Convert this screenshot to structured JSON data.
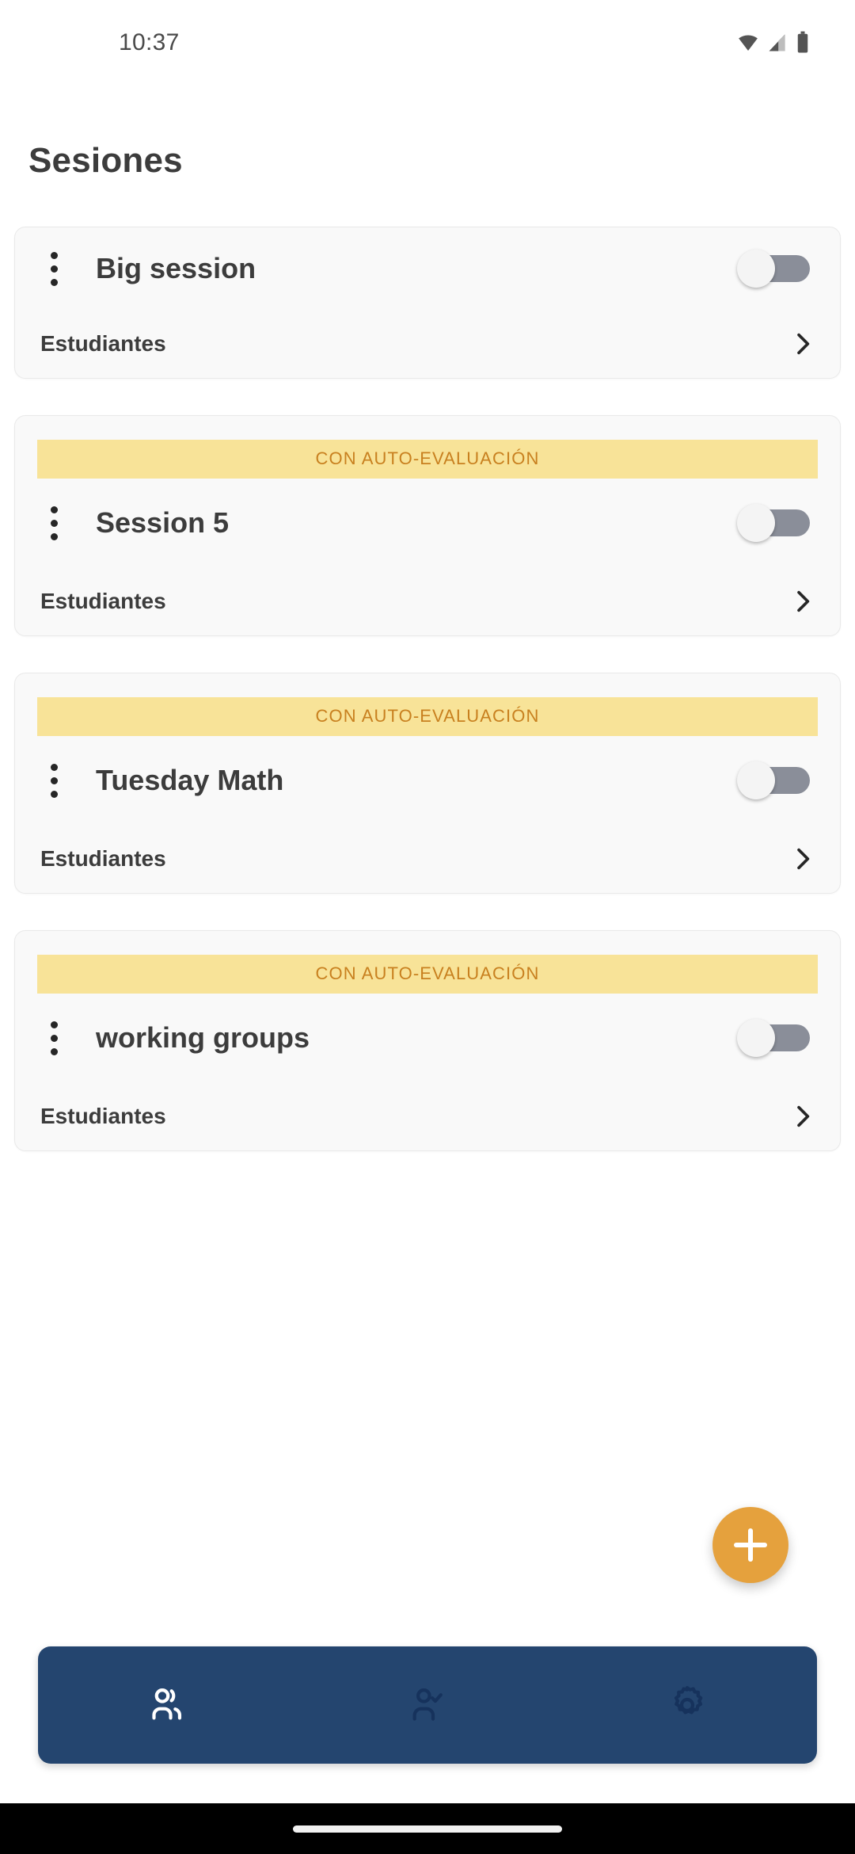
{
  "status_bar": {
    "time": "10:37",
    "icons": [
      "wifi-icon",
      "cellular-signal-icon",
      "battery-icon"
    ]
  },
  "header": {
    "title": "Sesiones"
  },
  "sessions": [
    {
      "title": "Big session",
      "banner": null,
      "toggle_on": false,
      "foot_label": "Estudiantes",
      "kebab_icon": "more-vertical-icon",
      "chevron_icon": "chevron-right-icon"
    },
    {
      "title": "Session 5",
      "banner": "CON AUTO-EVALUACIÓN",
      "toggle_on": false,
      "foot_label": "Estudiantes",
      "kebab_icon": "more-vertical-icon",
      "chevron_icon": "chevron-right-icon"
    },
    {
      "title": "Tuesday Math",
      "banner": "CON AUTO-EVALUACIÓN",
      "toggle_on": false,
      "foot_label": "Estudiantes",
      "kebab_icon": "more-vertical-icon",
      "chevron_icon": "chevron-right-icon"
    },
    {
      "title": "working groups",
      "banner": "CON AUTO-EVALUACIÓN",
      "toggle_on": false,
      "foot_label": "Estudiantes",
      "kebab_icon": "more-vertical-icon",
      "chevron_icon": "chevron-right-icon"
    }
  ],
  "fab": {
    "icon": "plus-icon",
    "label": "+"
  },
  "bottom_nav": {
    "items": [
      {
        "icon": "people-group-icon",
        "active": true
      },
      {
        "icon": "person-check-icon",
        "active": false
      },
      {
        "icon": "gear-icon",
        "active": false
      }
    ]
  },
  "colors": {
    "accent_orange": "#e5a13d",
    "banner_bg": "#f8e398",
    "banner_text": "#c8801f",
    "nav_bg": "#24456f",
    "card_bg": "#f9f9f9",
    "text_primary": "#3c3c3c",
    "toggle_track_off": "#8a8e99"
  }
}
